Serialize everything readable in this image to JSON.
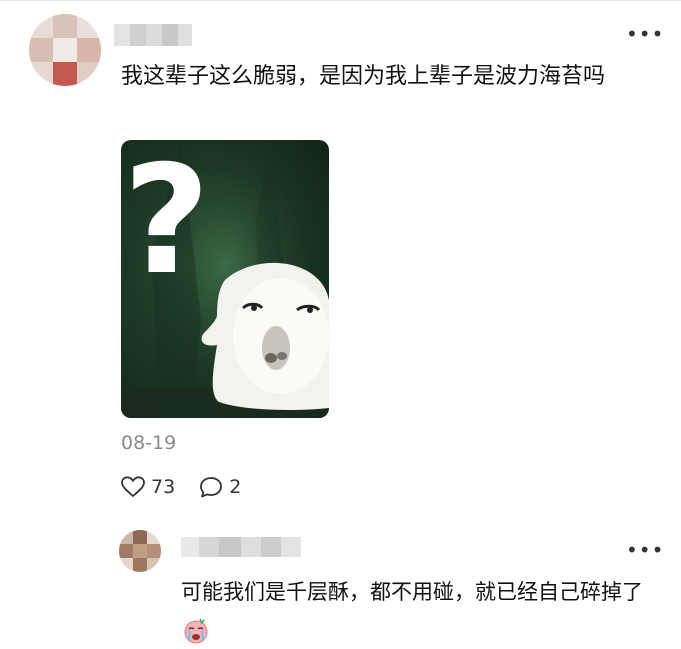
{
  "comment": {
    "text": "我这辈子这么脆弱，是因为我上辈子是波力海苔吗",
    "date": "08-19",
    "likes": "73",
    "replies": "2"
  },
  "reply": {
    "text": "可能我们是千层酥，都不用碰，就已经自己碎掉了",
    "emoji_icon": "crying-face-emoji"
  },
  "image": {
    "overlay_text": "?"
  },
  "colors": {
    "background": "#ffffff",
    "text": "#111111",
    "muted": "#8a8a8a",
    "photo_bg": "#1d3b26"
  }
}
